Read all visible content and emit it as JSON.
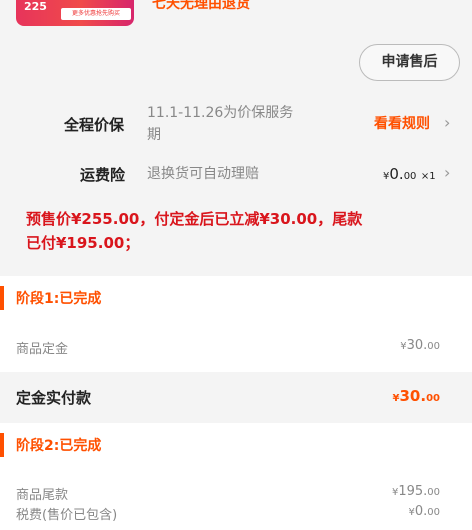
{
  "product": {
    "thumb_number": "225",
    "thumb_tag": "更多优惠抢先购买",
    "service_text": "七天无理由退货"
  },
  "after_sale_button": "申请售后",
  "price_protection": {
    "label": "全程价保",
    "desc_line1": "11.1-11.26为价保服务",
    "desc_line2": "期",
    "link": "看看规则"
  },
  "shipping_insurance": {
    "label": "运费险",
    "desc": "退换货可自动理赔",
    "price_symbol": "¥",
    "price_int": "0.",
    "price_dec": "00",
    "qty": "×1"
  },
  "presale_note_line1": "预售价¥255.00，付定金后已立减¥30.00，尾款",
  "presale_note_line2": "已付¥195.00；",
  "stage1": {
    "title": "阶段1:已完成",
    "item_label": "商品定金",
    "item_symbol": "¥",
    "item_int": "30.",
    "item_dec": "00"
  },
  "deposit_paid": {
    "label": "定金实付款",
    "symbol": "¥",
    "int": "30.",
    "dec": "00"
  },
  "stage2": {
    "title": "阶段2:已完成",
    "item1_label": "商品尾款",
    "item1_symbol": "¥",
    "item1_int": "195.",
    "item1_dec": "00",
    "item2_label": "税费(售价已包含)",
    "item2_symbol": "¥",
    "item2_int": "0.",
    "item2_dec": "00"
  },
  "colors": {
    "accent": "#ff5000",
    "note_red": "#d9151c"
  }
}
